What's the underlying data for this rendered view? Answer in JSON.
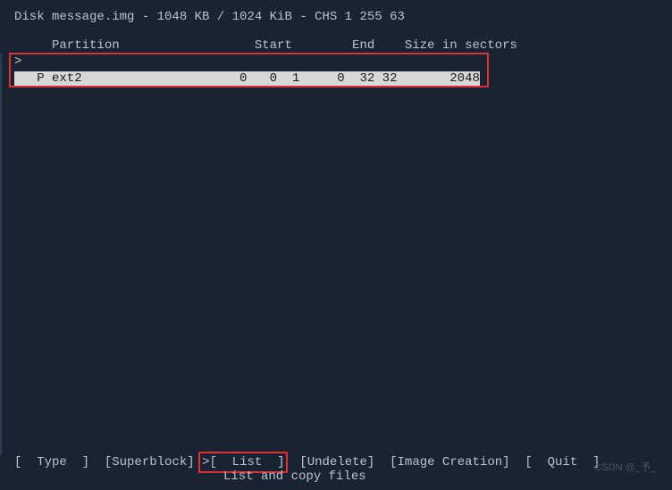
{
  "disk_info": "Disk message.img - 1048 KB / 1024 KiB - CHS 1 255 63",
  "headers": "     Partition                  Start        End    Size in sectors",
  "partition": {
    "pointer": ">",
    "row": "   P ext2                     0   0  1     0  32 32       2048"
  },
  "menu": {
    "type": "[  Type  ]",
    "superblock": "[Superblock]",
    "list_pointer": ">",
    "list": "[  List  ]",
    "undelete": "[Undelete]",
    "image": "[Image Creation]",
    "quit": "[  Quit  ]"
  },
  "menu_desc": "List and copy files",
  "watermark": "CSDN @_予_"
}
